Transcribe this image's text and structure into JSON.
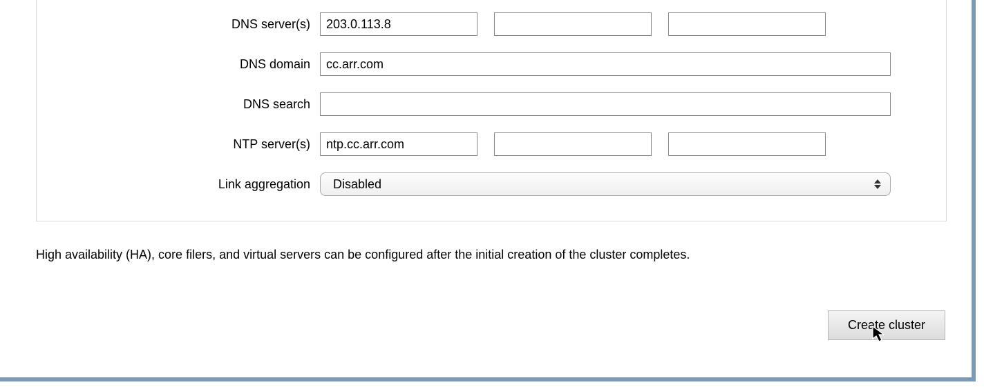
{
  "form": {
    "dns_servers": {
      "label": "DNS server(s)",
      "values": [
        "203.0.113.8",
        "",
        ""
      ]
    },
    "dns_domain": {
      "label": "DNS domain",
      "value": "cc.arr.com"
    },
    "dns_search": {
      "label": "DNS search",
      "value": ""
    },
    "ntp_servers": {
      "label": "NTP server(s)",
      "values": [
        "ntp.cc.arr.com",
        "",
        ""
      ]
    },
    "link_aggregation": {
      "label": "Link aggregation",
      "selected": "Disabled"
    }
  },
  "help_text": "High availability (HA), core filers, and virtual servers can be configured after the initial creation of the cluster completes.",
  "actions": {
    "create_cluster": "Create cluster"
  }
}
